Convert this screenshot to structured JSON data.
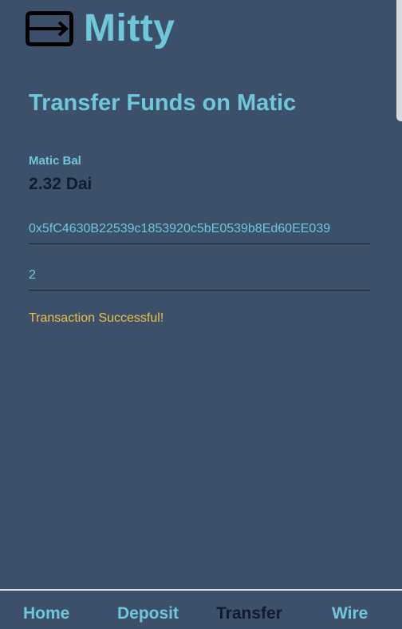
{
  "app": {
    "title": "Mitty",
    "logo_icon": "transfer-arrow-icon"
  },
  "page": {
    "title": "Transfer Funds on Matic"
  },
  "balance": {
    "label": "Matic Bal",
    "value": "2.32 Dai"
  },
  "form": {
    "address_value": "0x5fC4630B22539c1853920c5bE0539b8Ed60EE039",
    "amount_value": "2"
  },
  "status": {
    "message": "Transaction Successful!"
  },
  "nav": {
    "items": [
      {
        "label": "Home"
      },
      {
        "label": "Deposit"
      },
      {
        "label": "Transfer"
      },
      {
        "label": "Wire"
      }
    ],
    "active": "Transfer"
  },
  "colors": {
    "background": "#3d5069",
    "accent": "#6ec8da",
    "dark_text": "#111a33",
    "success": "#e8c14a"
  }
}
